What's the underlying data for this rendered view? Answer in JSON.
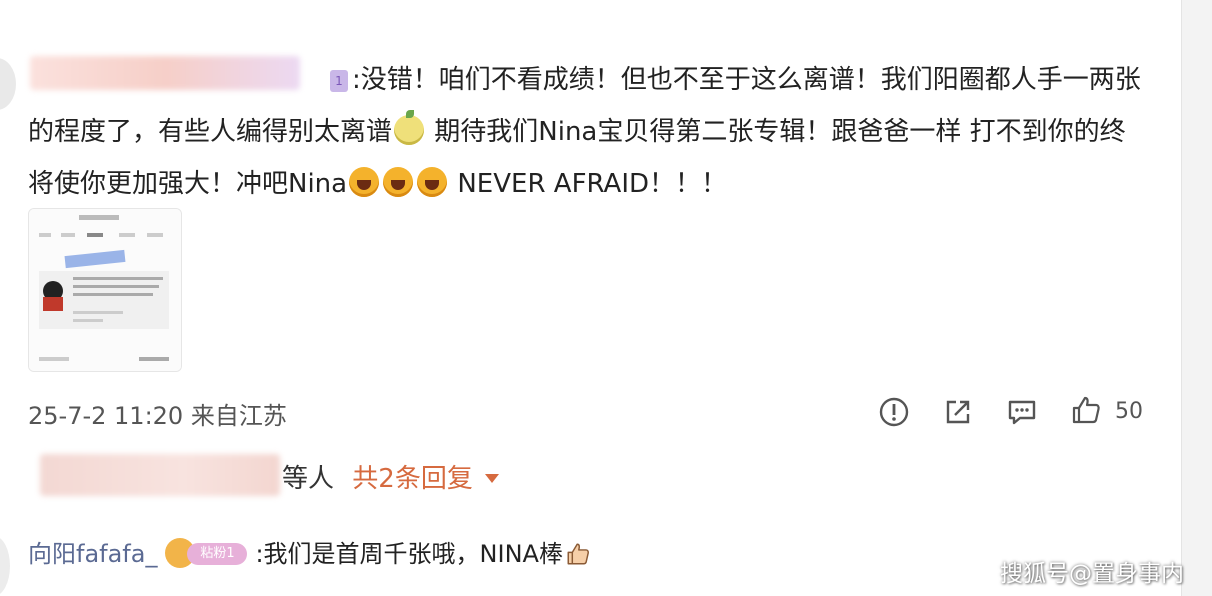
{
  "comment": {
    "level_badge": "1",
    "text_parts": [
      ":没错！咱们不看成绩！但也不至于这么离谱！我们阳圈都人手一两张的程度了，有些人编得别太离谱",
      "期待我们Nina宝贝得第二张专辑！跟爸爸一样 打不到你的终将使你更加强大！冲吧Nina",
      "NEVER AFRAID！！！"
    ],
    "emojis": [
      "melon-icon",
      "laugh-icon",
      "laugh-icon",
      "laugh-icon"
    ],
    "image_alt": "screenshot-thumbnail",
    "timestamp": "25-7-2 11:20 来自江苏",
    "like_count": "50",
    "icons": [
      "report-icon",
      "share-icon",
      "comment-icon",
      "like-icon"
    ]
  },
  "replies": {
    "prefix_visible": "等人",
    "count_label": "共2条回复"
  },
  "sub_comment": {
    "user": "向阳fafafa_",
    "badge": "粘粉1",
    "text": ":我们是首周千张哦，NINA棒"
  },
  "watermark": "搜狐号@置身事内",
  "colors": {
    "reply_accent": "#d66a3f",
    "username": "#5b6a93",
    "text": "#222222"
  }
}
